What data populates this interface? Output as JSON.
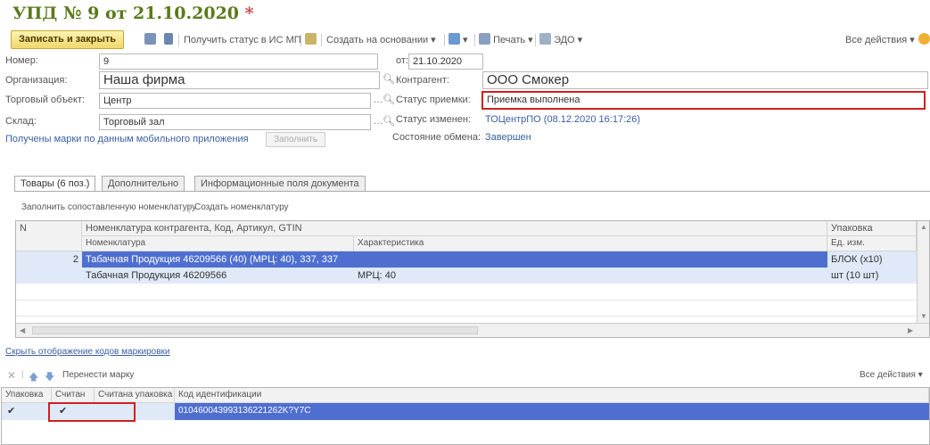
{
  "title": {
    "text": "УПД № 9 от 21.10.2020",
    "modified_marker": "*"
  },
  "toolbar": {
    "save_close": "Записать и закрыть",
    "get_status": "Получить статус в ИС МП",
    "create_based": "Создать на основании",
    "print": "Печать",
    "edo": "ЭДО",
    "all_actions": "Все действия"
  },
  "form": {
    "number_label": "Номер:",
    "number_value": "9",
    "date_label": "от:",
    "date_value": "21.10.2020",
    "org_label": "Организация:",
    "org_value": "Наша фирма",
    "contractor_label": "Контрагент:",
    "contractor_value": "ООО Смокер",
    "trade_label": "Торговый объект:",
    "trade_value": "Центр",
    "accept_status_label": "Статус приемки:",
    "accept_status_value": "Приемка выполнена",
    "warehouse_label": "Склад:",
    "warehouse_value": "Торговый зал",
    "status_changed_label": "Статус изменен:",
    "status_changed_value": "ТОЦентрПО (08.12.2020 16:17:26)",
    "exchange_label": "Состояние обмена:",
    "exchange_value": "Завершен",
    "marks_received": "Получены марки по данным мобильного приложения",
    "fill_button": "Заполнить"
  },
  "tabs": [
    "Товары (6 поз.)",
    "Дополнительно",
    "Информационные поля документа"
  ],
  "goods": {
    "fill_matched": "Заполнить сопоставленную номенклатуру",
    "create_nomenclature": "Создать номенклатуру",
    "col_n": "N",
    "col_nom_contractor": "Номенклатура контрагента, Код, Артикул, GTIN",
    "col_nomenclature": "Номенклатура",
    "col_characteristic": "Характеристика",
    "col_package": "Упаковка",
    "col_unit": "Ед. изм.",
    "rows": [
      {
        "n": "2",
        "contractor": "Табачная Продукция 46209566 (40) (МРЦ: 40), 337, 337",
        "package": "БЛОК (x10)"
      },
      {
        "nomenclature": "Табачная Продукция 46209566",
        "characteristic": "МРЦ: 40",
        "unit": "шт (10 шт)"
      }
    ]
  },
  "marks": {
    "hide_codes": "Скрыть отображение кодов маркировки",
    "move_mark": "Перенести марку",
    "all_actions": "Все действия",
    "col_package": "Упаковка",
    "col_scanned": "Считан",
    "col_scanned_pkg": "Считана упаковка",
    "col_code": "Код идентификации",
    "row_package": "✔",
    "row_scanned": "✔",
    "row_code": "010460043993136221262K?Y7C"
  },
  "colors": {
    "accent_red": "#d02020",
    "selection": "#4f6fd0",
    "title_green": "#5a7a1a"
  }
}
